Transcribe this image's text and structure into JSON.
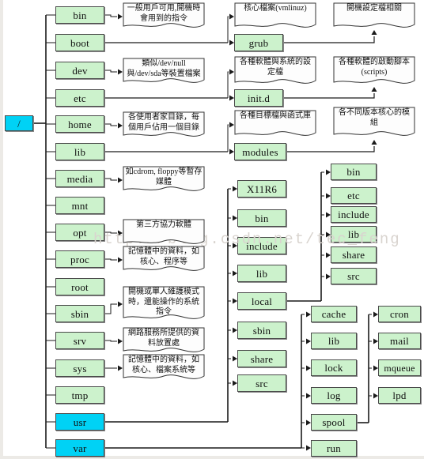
{
  "title": "Linux Filesystem Hierarchy Tree",
  "watermark": "http://blog.csdn.net/tec_feng",
  "colors": {
    "box_fill": "#ccf2cc",
    "root_fill": "#00d2f5",
    "box_border": "#4a4a4a",
    "line": "#1a1a1a",
    "watermark": "#d9d4cf",
    "background": "#ffffff"
  },
  "root": {
    "label": "/"
  },
  "level1": [
    {
      "label": "bin"
    },
    {
      "label": "boot"
    },
    {
      "label": "dev"
    },
    {
      "label": "etc"
    },
    {
      "label": "home"
    },
    {
      "label": "lib"
    },
    {
      "label": "media"
    },
    {
      "label": "mnt"
    },
    {
      "label": "opt"
    },
    {
      "label": "proc"
    },
    {
      "label": "root"
    },
    {
      "label": "sbin"
    },
    {
      "label": "srv"
    },
    {
      "label": "sys"
    },
    {
      "label": "tmp"
    },
    {
      "label": "usr"
    },
    {
      "label": "var"
    }
  ],
  "notes_col1": [
    {
      "for": "bin",
      "text": "一般用戶可用,開機時會用到的指令"
    },
    {
      "for": "dev",
      "text": "類似/dev/null與/dev/sda等裝置檔案"
    },
    {
      "for": "home",
      "text": "各使用者家目錄，每個用戶佔用一個目錄"
    },
    {
      "for": "media",
      "text": "如cdrom, floppy等暫存媒體"
    },
    {
      "for": "opt",
      "text": "第三方協力軟體"
    },
    {
      "for": "proc",
      "text": "記憶體中的資料，如核心、程序等"
    },
    {
      "for": "sbin",
      "text": "開機或單人維護模式時，還能操作的系統指令"
    },
    {
      "for": "srv",
      "text": "網路服務所提供的資料放置處"
    },
    {
      "for": "sys",
      "text": "記憶體中的資料，如核心、檔案系統等"
    }
  ],
  "boot_children": [
    {
      "label": "grub"
    }
  ],
  "etc_children": [
    {
      "label": "init.d"
    }
  ],
  "lib_children": [
    {
      "label": "modules"
    }
  ],
  "notes_col2": [
    {
      "for": "boot",
      "text": "核心檔案(vmlinuz)"
    },
    {
      "for": "etc",
      "text": "各種軟體與系統的設定檔"
    },
    {
      "for": "lib",
      "text": "各種目標檔與函式庫"
    }
  ],
  "notes_col3": [
    {
      "for": "grub",
      "text": "開機設定檔相關"
    },
    {
      "for": "init.d",
      "text": "各種軟體的啟動腳本(scripts)"
    },
    {
      "for": "modules",
      "text": "各不同版本核心的模組"
    }
  ],
  "usr_children": [
    {
      "label": "X11R6"
    },
    {
      "label": "bin"
    },
    {
      "label": "include"
    },
    {
      "label": "lib"
    },
    {
      "label": "local"
    },
    {
      "label": "sbin"
    },
    {
      "label": "share"
    },
    {
      "label": "src"
    }
  ],
  "usr_local_children": [
    {
      "label": "bin"
    },
    {
      "label": "etc"
    },
    {
      "label": "include"
    },
    {
      "label": "lib"
    },
    {
      "label": "share"
    },
    {
      "label": "src"
    }
  ],
  "var_children": [
    {
      "label": "cache"
    },
    {
      "label": "lib"
    },
    {
      "label": "lock"
    },
    {
      "label": "log"
    },
    {
      "label": "spool"
    },
    {
      "label": "run"
    }
  ],
  "var_spool_children": [
    {
      "label": "cron"
    },
    {
      "label": "mail"
    },
    {
      "label": "mqueue"
    },
    {
      "label": "lpd"
    }
  ]
}
